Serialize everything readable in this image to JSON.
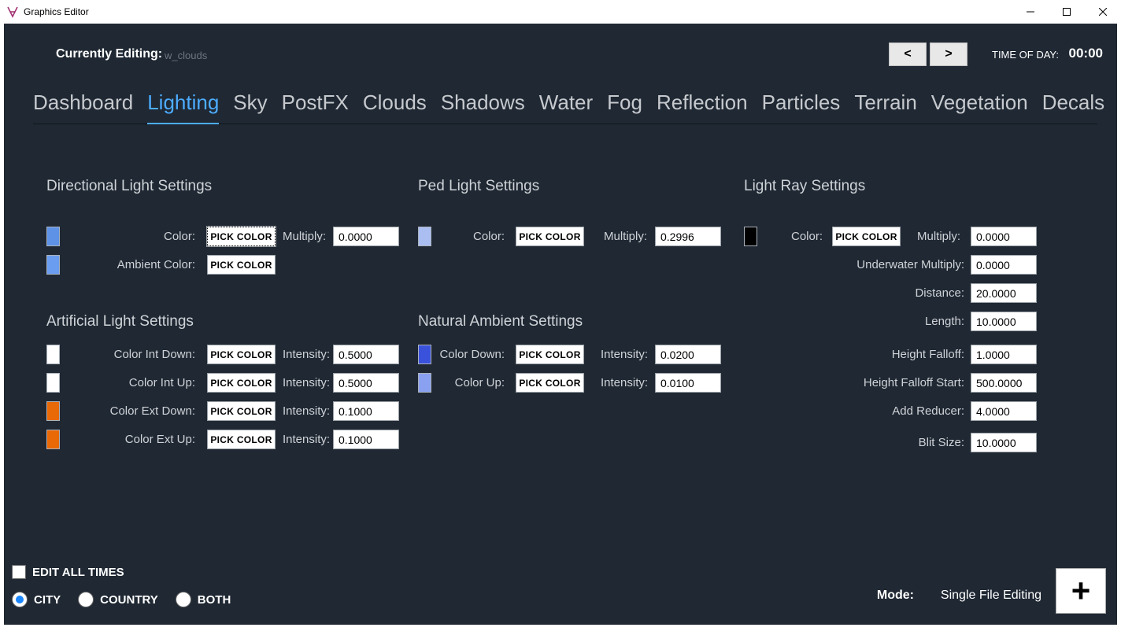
{
  "window": {
    "title": "Graphics Editor"
  },
  "header": {
    "editing_label": "Currently Editing:",
    "editing_value": "w_clouds",
    "prev": "<",
    "next": ">",
    "tod_label": "TIME OF DAY:",
    "tod_value": "00:00"
  },
  "tabs": [
    {
      "id": "dashboard",
      "label": "Dashboard",
      "active": false
    },
    {
      "id": "lighting",
      "label": "Lighting",
      "active": true
    },
    {
      "id": "sky",
      "label": "Sky",
      "active": false
    },
    {
      "id": "postfx",
      "label": "PostFX",
      "active": false
    },
    {
      "id": "clouds",
      "label": "Clouds",
      "active": false
    },
    {
      "id": "shadows",
      "label": "Shadows",
      "active": false
    },
    {
      "id": "water",
      "label": "Water",
      "active": false
    },
    {
      "id": "fog",
      "label": "Fog",
      "active": false
    },
    {
      "id": "reflection",
      "label": "Reflection",
      "active": false
    },
    {
      "id": "particles",
      "label": "Particles",
      "active": false
    },
    {
      "id": "terrain",
      "label": "Terrain",
      "active": false
    },
    {
      "id": "vegetation",
      "label": "Vegetation",
      "active": false
    },
    {
      "id": "decals",
      "label": "Decals",
      "active": false
    }
  ],
  "labels": {
    "pick": "PICK COLOR",
    "multiply": "Multiply:",
    "intensity": "Intensity:"
  },
  "directional": {
    "title": "Directional Light Settings",
    "color_label": "Color:",
    "color_swatch": "#5d92e6",
    "multiply_value": "0.0000",
    "ambient_label": "Ambient Color:",
    "ambient_swatch": "#6a9cf0"
  },
  "ped": {
    "title": "Ped Light Settings",
    "color_label": "Color:",
    "color_swatch": "#abbef2",
    "multiply_value": "0.2996"
  },
  "lightray": {
    "title": "Light Ray Settings",
    "color_label": "Color:",
    "color_swatch": "#000000",
    "multiply_value": "0.0000",
    "underwater_label": "Underwater Multiply:",
    "underwater_value": "0.0000",
    "distance_label": "Distance:",
    "distance_value": "20.0000",
    "length_label": "Length:",
    "length_value": "10.0000",
    "hfalloff_label": "Height Falloff:",
    "hfalloff_value": "1.0000",
    "hfstart_label": "Height Falloff Start:",
    "hfstart_value": "500.0000",
    "addreducer_label": "Add Reducer:",
    "addreducer_value": "4.0000",
    "blit_label": "Blit Size:",
    "blit_value": "10.0000"
  },
  "artificial": {
    "title": "Artificial Light Settings",
    "rows": [
      {
        "label": "Color Int Down:",
        "swatch": "#ffffff",
        "intensity": "0.5000"
      },
      {
        "label": "Color Int Up:",
        "swatch": "#ffffff",
        "intensity": "0.5000"
      },
      {
        "label": "Color Ext Down:",
        "swatch": "#e86906",
        "intensity": "0.1000"
      },
      {
        "label": "Color Ext Up:",
        "swatch": "#e86906",
        "intensity": "0.1000"
      }
    ]
  },
  "natural": {
    "title": "Natural Ambient Settings",
    "rows": [
      {
        "label": "Color Down:",
        "swatch": "#3a51db",
        "intensity": "0.0200"
      },
      {
        "label": "Color Up:",
        "swatch": "#8aa0f0",
        "intensity": "0.0100"
      }
    ]
  },
  "footer": {
    "edit_all_times": "EDIT ALL TIMES",
    "radio": [
      {
        "id": "city",
        "label": "CITY",
        "selected": true
      },
      {
        "id": "country",
        "label": "COUNTRY",
        "selected": false
      },
      {
        "id": "both",
        "label": "BOTH",
        "selected": false
      }
    ],
    "mode_label": "Mode:",
    "mode_value": "Single File Editing",
    "plus": "+"
  }
}
